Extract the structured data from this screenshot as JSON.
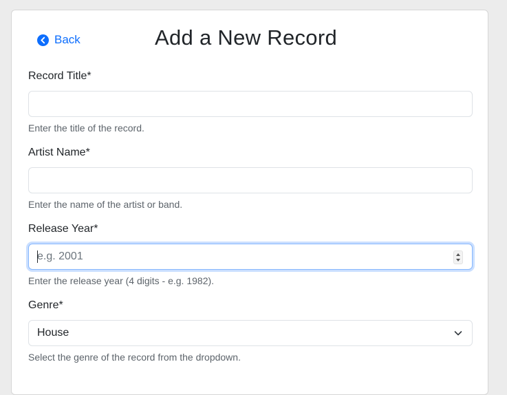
{
  "header": {
    "back_label": "Back",
    "title": "Add a New Record"
  },
  "form": {
    "record_title": {
      "label": "Record Title*",
      "value": "",
      "help": "Enter the title of the record."
    },
    "artist_name": {
      "label": "Artist Name*",
      "value": "",
      "help": "Enter the name of the artist or band."
    },
    "release_year": {
      "label": "Release Year*",
      "placeholder": "e.g. 2001",
      "help": "Enter the release year (4 digits - e.g. 1982)."
    },
    "genre": {
      "label": "Genre*",
      "selected": "House",
      "help": "Select the genre of the record from the dropdown."
    }
  },
  "colors": {
    "accent": "#0d6efd",
    "focus_ring": "#86b7fe"
  },
  "icons": {
    "back": "chevron-left-circle-icon",
    "select": "chevron-down-icon"
  }
}
